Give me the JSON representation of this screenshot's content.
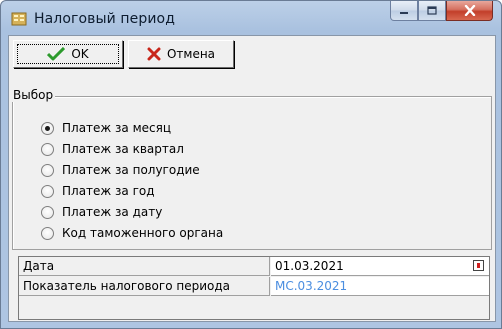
{
  "window": {
    "title": "Налоговый период"
  },
  "toolbar": {
    "ok_label": "OK",
    "cancel_label": "Отмена"
  },
  "group": {
    "title": "Выбор",
    "options": [
      {
        "label": "Платеж за месяц",
        "checked": true
      },
      {
        "label": "Платеж за квартал",
        "checked": false
      },
      {
        "label": "Платеж за полугодие",
        "checked": false
      },
      {
        "label": "Платеж за год",
        "checked": false
      },
      {
        "label": "Платеж за дату",
        "checked": false
      },
      {
        "label": "Код таможенного органа",
        "checked": false
      }
    ]
  },
  "grid": {
    "rows": [
      {
        "label": "Дата",
        "value": "01.03.2021"
      },
      {
        "label": "Показатель налогового периода",
        "value": "МС.03.2021"
      }
    ]
  },
  "colors": {
    "accent_value": "#4b8ee0",
    "ok_check": "#2c9a2c",
    "cancel_cross": "#c8261a",
    "close_button": "#c23e2a"
  },
  "icons": [
    "app-coins-icon",
    "minimize-icon",
    "maximize-icon",
    "close-icon",
    "checkmark-icon",
    "cross-icon",
    "calendar-icon"
  ]
}
